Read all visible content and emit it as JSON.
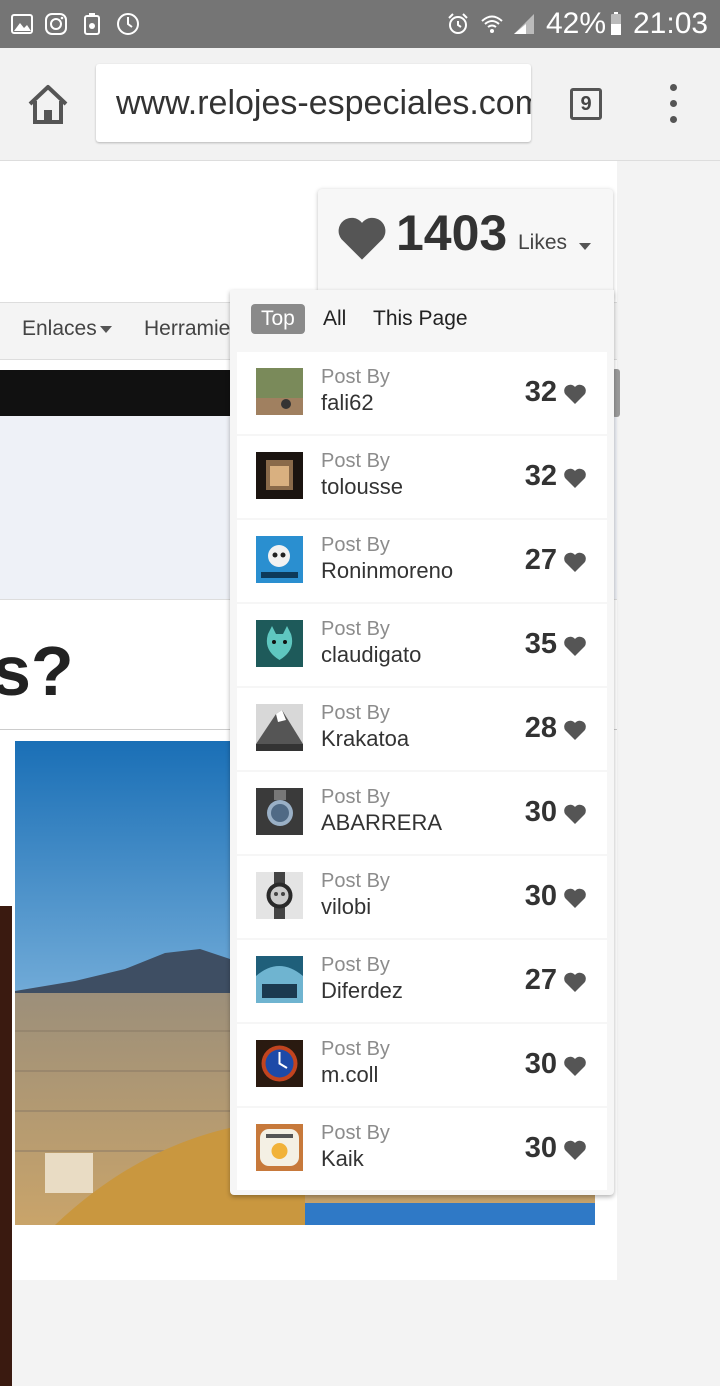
{
  "status_bar": {
    "battery": "42%",
    "time": "21:03"
  },
  "browser": {
    "url": "www.relojes-especiales.com",
    "tab_count": "9"
  },
  "page": {
    "nav": [
      {
        "label": "Enlaces",
        "has_caret": true
      },
      {
        "label": "Herramie",
        "has_caret": false
      }
    ],
    "heading": "s?"
  },
  "likes": {
    "count": "1403",
    "label": "Likes",
    "tabs": [
      {
        "label": "Top",
        "active": true
      },
      {
        "label": "All",
        "active": false
      },
      {
        "label": "This Page",
        "active": false
      }
    ],
    "post_by_label": "Post By",
    "posts": [
      {
        "author": "fali62",
        "likes": "32"
      },
      {
        "author": "tolousse",
        "likes": "32"
      },
      {
        "author": "Roninmoreno",
        "likes": "27"
      },
      {
        "author": "claudigato",
        "likes": "35"
      },
      {
        "author": "Krakatoa",
        "likes": "28"
      },
      {
        "author": "ABARRERA",
        "likes": "30"
      },
      {
        "author": "vilobi",
        "likes": "30"
      },
      {
        "author": "Diferdez",
        "likes": "27"
      },
      {
        "author": "m.coll",
        "likes": "30"
      },
      {
        "author": "Kaik",
        "likes": "30"
      }
    ]
  },
  "colors": {
    "status_bar": "#757575",
    "heart": "#555555",
    "active_tab": "#8a8a8a"
  }
}
